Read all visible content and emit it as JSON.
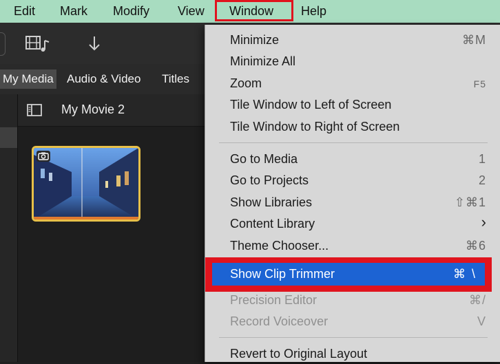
{
  "menubar": {
    "items": [
      "Edit",
      "Mark",
      "Modify",
      "View",
      "Window",
      "Help"
    ]
  },
  "media_tabs": [
    "My Media",
    "Audio & Video",
    "Titles"
  ],
  "project": {
    "title": "My Movie 2"
  },
  "window_menu": {
    "items": [
      {
        "label": "Minimize",
        "shortcut": "⌘M"
      },
      {
        "label": "Minimize All",
        "shortcut": ""
      },
      {
        "label": "Zoom",
        "shortcut": "F5"
      },
      {
        "label": "Tile Window to Left of Screen",
        "shortcut": ""
      },
      {
        "label": "Tile Window to Right of Screen",
        "shortcut": ""
      },
      {
        "label": "Go to Media",
        "shortcut": "1"
      },
      {
        "label": "Go to Projects",
        "shortcut": "2"
      },
      {
        "label": "Show Libraries",
        "shortcut": "⇧⌘1"
      },
      {
        "label": "Content Library",
        "shortcut": "›"
      },
      {
        "label": "Theme Chooser...",
        "shortcut": "⌘6"
      },
      {
        "label": "Show Clip Trimmer",
        "shortcut": "⌘ \\"
      },
      {
        "label": "Precision Editor",
        "shortcut": "⌘/"
      },
      {
        "label": "Record Voiceover",
        "shortcut": "V"
      },
      {
        "label": "Revert to Original Layout",
        "shortcut": ""
      }
    ]
  },
  "colors": {
    "menubar_bg": "#a8dcc0",
    "highlight_blue": "#1c63d3",
    "callout_red": "#e0141e",
    "clip_border": "#e8c048"
  },
  "icons": [
    "film-music-icon",
    "download-arrow-icon",
    "sidebar-toggle-icon",
    "camera-icon"
  ]
}
